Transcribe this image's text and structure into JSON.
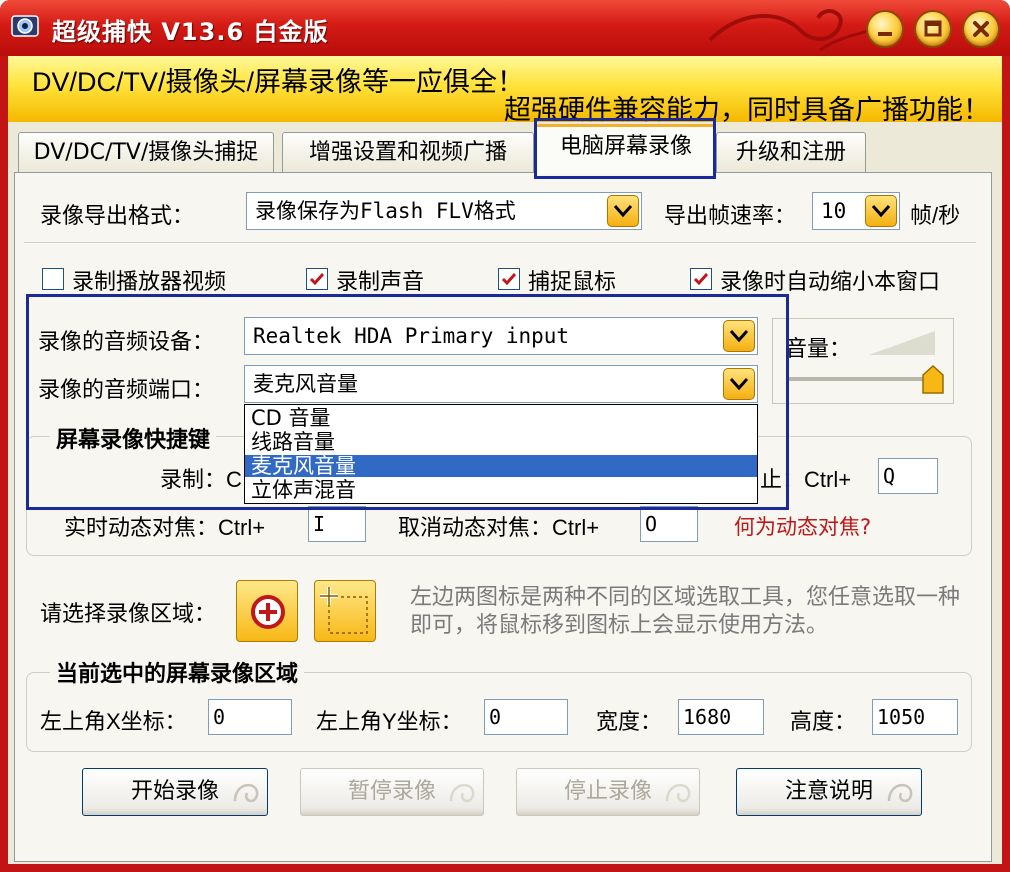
{
  "window": {
    "title": "超级捕快 V13.6 白金版",
    "minimize_icon": "minimize-icon",
    "restore_icon": "restore-icon",
    "close_icon": "close-icon"
  },
  "banner": {
    "line1": "DV/DC/TV/摄像头/屏幕录像等一应俱全！",
    "line2": "超强硬件兼容能力，同时具备广播功能！"
  },
  "tabs": [
    {
      "label": "DV/DC/TV/摄像头捕捉"
    },
    {
      "label": "增强设置和视频广播"
    },
    {
      "label": "电脑屏幕录像"
    },
    {
      "label": "升级和注册"
    }
  ],
  "export": {
    "format_label": "录像导出格式：",
    "format_value": "录像保存为Flash FLV格式",
    "fps_label": "导出帧速率：",
    "fps_value": "10",
    "fps_unit": "帧/秒"
  },
  "options": [
    {
      "label": "录制播放器视频",
      "checked": false
    },
    {
      "label": "录制声音",
      "checked": true
    },
    {
      "label": "捕捉鼠标",
      "checked": true
    },
    {
      "label": "录像时自动缩小本窗口",
      "checked": true
    }
  ],
  "audio": {
    "device_label": "录像的音频设备：",
    "device_value": "Realtek HDA Primary input",
    "port_label": "录像的音频端口：",
    "port_value": "麦克风音量",
    "port_options": [
      "CD 音量",
      "线路音量",
      "麦克风音量",
      "立体声混音"
    ],
    "volume_label": "音量："
  },
  "hotkeys": {
    "group_title": "屏幕录像快捷键",
    "record_label": "录制：C",
    "stop_label": "止：Ctrl+",
    "stop_value": "Q",
    "focus_label": "实时动态对焦：Ctrl+",
    "focus_value": "I",
    "cancel_focus_label": "取消动态对焦：Ctrl+",
    "cancel_focus_value": "O",
    "help_link": "何为动态对焦?"
  },
  "region": {
    "select_label": "请选择录像区域：",
    "hint": "左边两图标是两种不同的区域选取工具，您任意选取一种即可，将鼠标移到图标上会显示使用方法。",
    "current_title": "当前选中的屏幕录像区域",
    "x_label": "左上角X坐标：",
    "x_value": "0",
    "y_label": "左上角Y坐标：",
    "y_value": "0",
    "width_label": "宽度：",
    "width_value": "1680",
    "height_label": "高度：",
    "height_value": "1050"
  },
  "buttons": {
    "start": "开始录像",
    "pause": "暂停录像",
    "stop": "停止录像",
    "notes": "注意说明"
  },
  "colors": {
    "titlebar": "#d41a14",
    "banner": "#ffe23a",
    "highlight_frame": "#1a2a9a",
    "selection": "#316ac5",
    "link": "#c01818"
  }
}
